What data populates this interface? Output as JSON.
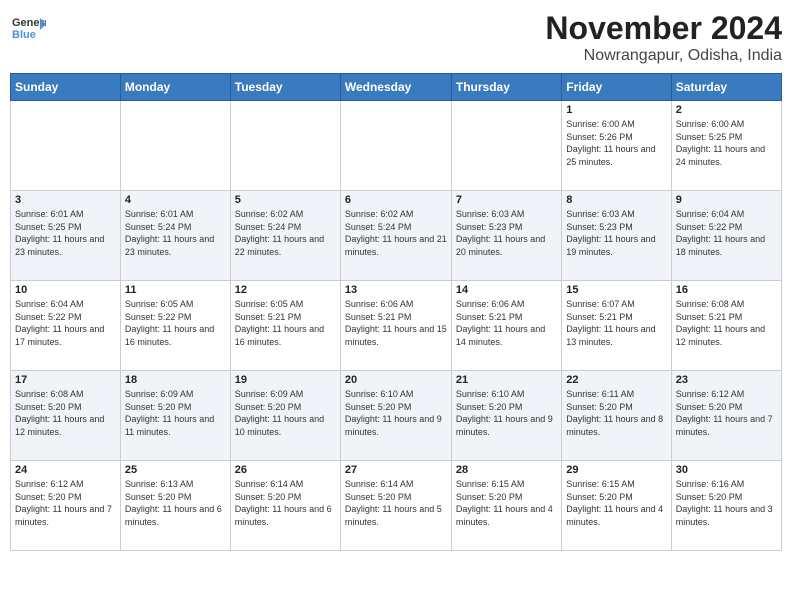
{
  "logo": {
    "line1": "General",
    "line2": "Blue"
  },
  "title": "November 2024",
  "subtitle": "Nowrangapur, Odisha, India",
  "days_of_week": [
    "Sunday",
    "Monday",
    "Tuesday",
    "Wednesday",
    "Thursday",
    "Friday",
    "Saturday"
  ],
  "weeks": [
    [
      {
        "day": "",
        "info": ""
      },
      {
        "day": "",
        "info": ""
      },
      {
        "day": "",
        "info": ""
      },
      {
        "day": "",
        "info": ""
      },
      {
        "day": "",
        "info": ""
      },
      {
        "day": "1",
        "info": "Sunrise: 6:00 AM\nSunset: 5:26 PM\nDaylight: 11 hours and 25 minutes."
      },
      {
        "day": "2",
        "info": "Sunrise: 6:00 AM\nSunset: 5:25 PM\nDaylight: 11 hours and 24 minutes."
      }
    ],
    [
      {
        "day": "3",
        "info": "Sunrise: 6:01 AM\nSunset: 5:25 PM\nDaylight: 11 hours and 23 minutes."
      },
      {
        "day": "4",
        "info": "Sunrise: 6:01 AM\nSunset: 5:24 PM\nDaylight: 11 hours and 23 minutes."
      },
      {
        "day": "5",
        "info": "Sunrise: 6:02 AM\nSunset: 5:24 PM\nDaylight: 11 hours and 22 minutes."
      },
      {
        "day": "6",
        "info": "Sunrise: 6:02 AM\nSunset: 5:24 PM\nDaylight: 11 hours and 21 minutes."
      },
      {
        "day": "7",
        "info": "Sunrise: 6:03 AM\nSunset: 5:23 PM\nDaylight: 11 hours and 20 minutes."
      },
      {
        "day": "8",
        "info": "Sunrise: 6:03 AM\nSunset: 5:23 PM\nDaylight: 11 hours and 19 minutes."
      },
      {
        "day": "9",
        "info": "Sunrise: 6:04 AM\nSunset: 5:22 PM\nDaylight: 11 hours and 18 minutes."
      }
    ],
    [
      {
        "day": "10",
        "info": "Sunrise: 6:04 AM\nSunset: 5:22 PM\nDaylight: 11 hours and 17 minutes."
      },
      {
        "day": "11",
        "info": "Sunrise: 6:05 AM\nSunset: 5:22 PM\nDaylight: 11 hours and 16 minutes."
      },
      {
        "day": "12",
        "info": "Sunrise: 6:05 AM\nSunset: 5:21 PM\nDaylight: 11 hours and 16 minutes."
      },
      {
        "day": "13",
        "info": "Sunrise: 6:06 AM\nSunset: 5:21 PM\nDaylight: 11 hours and 15 minutes."
      },
      {
        "day": "14",
        "info": "Sunrise: 6:06 AM\nSunset: 5:21 PM\nDaylight: 11 hours and 14 minutes."
      },
      {
        "day": "15",
        "info": "Sunrise: 6:07 AM\nSunset: 5:21 PM\nDaylight: 11 hours and 13 minutes."
      },
      {
        "day": "16",
        "info": "Sunrise: 6:08 AM\nSunset: 5:21 PM\nDaylight: 11 hours and 12 minutes."
      }
    ],
    [
      {
        "day": "17",
        "info": "Sunrise: 6:08 AM\nSunset: 5:20 PM\nDaylight: 11 hours and 12 minutes."
      },
      {
        "day": "18",
        "info": "Sunrise: 6:09 AM\nSunset: 5:20 PM\nDaylight: 11 hours and 11 minutes."
      },
      {
        "day": "19",
        "info": "Sunrise: 6:09 AM\nSunset: 5:20 PM\nDaylight: 11 hours and 10 minutes."
      },
      {
        "day": "20",
        "info": "Sunrise: 6:10 AM\nSunset: 5:20 PM\nDaylight: 11 hours and 9 minutes."
      },
      {
        "day": "21",
        "info": "Sunrise: 6:10 AM\nSunset: 5:20 PM\nDaylight: 11 hours and 9 minutes."
      },
      {
        "day": "22",
        "info": "Sunrise: 6:11 AM\nSunset: 5:20 PM\nDaylight: 11 hours and 8 minutes."
      },
      {
        "day": "23",
        "info": "Sunrise: 6:12 AM\nSunset: 5:20 PM\nDaylight: 11 hours and 7 minutes."
      }
    ],
    [
      {
        "day": "24",
        "info": "Sunrise: 6:12 AM\nSunset: 5:20 PM\nDaylight: 11 hours and 7 minutes."
      },
      {
        "day": "25",
        "info": "Sunrise: 6:13 AM\nSunset: 5:20 PM\nDaylight: 11 hours and 6 minutes."
      },
      {
        "day": "26",
        "info": "Sunrise: 6:14 AM\nSunset: 5:20 PM\nDaylight: 11 hours and 6 minutes."
      },
      {
        "day": "27",
        "info": "Sunrise: 6:14 AM\nSunset: 5:20 PM\nDaylight: 11 hours and 5 minutes."
      },
      {
        "day": "28",
        "info": "Sunrise: 6:15 AM\nSunset: 5:20 PM\nDaylight: 11 hours and 4 minutes."
      },
      {
        "day": "29",
        "info": "Sunrise: 6:15 AM\nSunset: 5:20 PM\nDaylight: 11 hours and 4 minutes."
      },
      {
        "day": "30",
        "info": "Sunrise: 6:16 AM\nSunset: 5:20 PM\nDaylight: 11 hours and 3 minutes."
      }
    ]
  ]
}
